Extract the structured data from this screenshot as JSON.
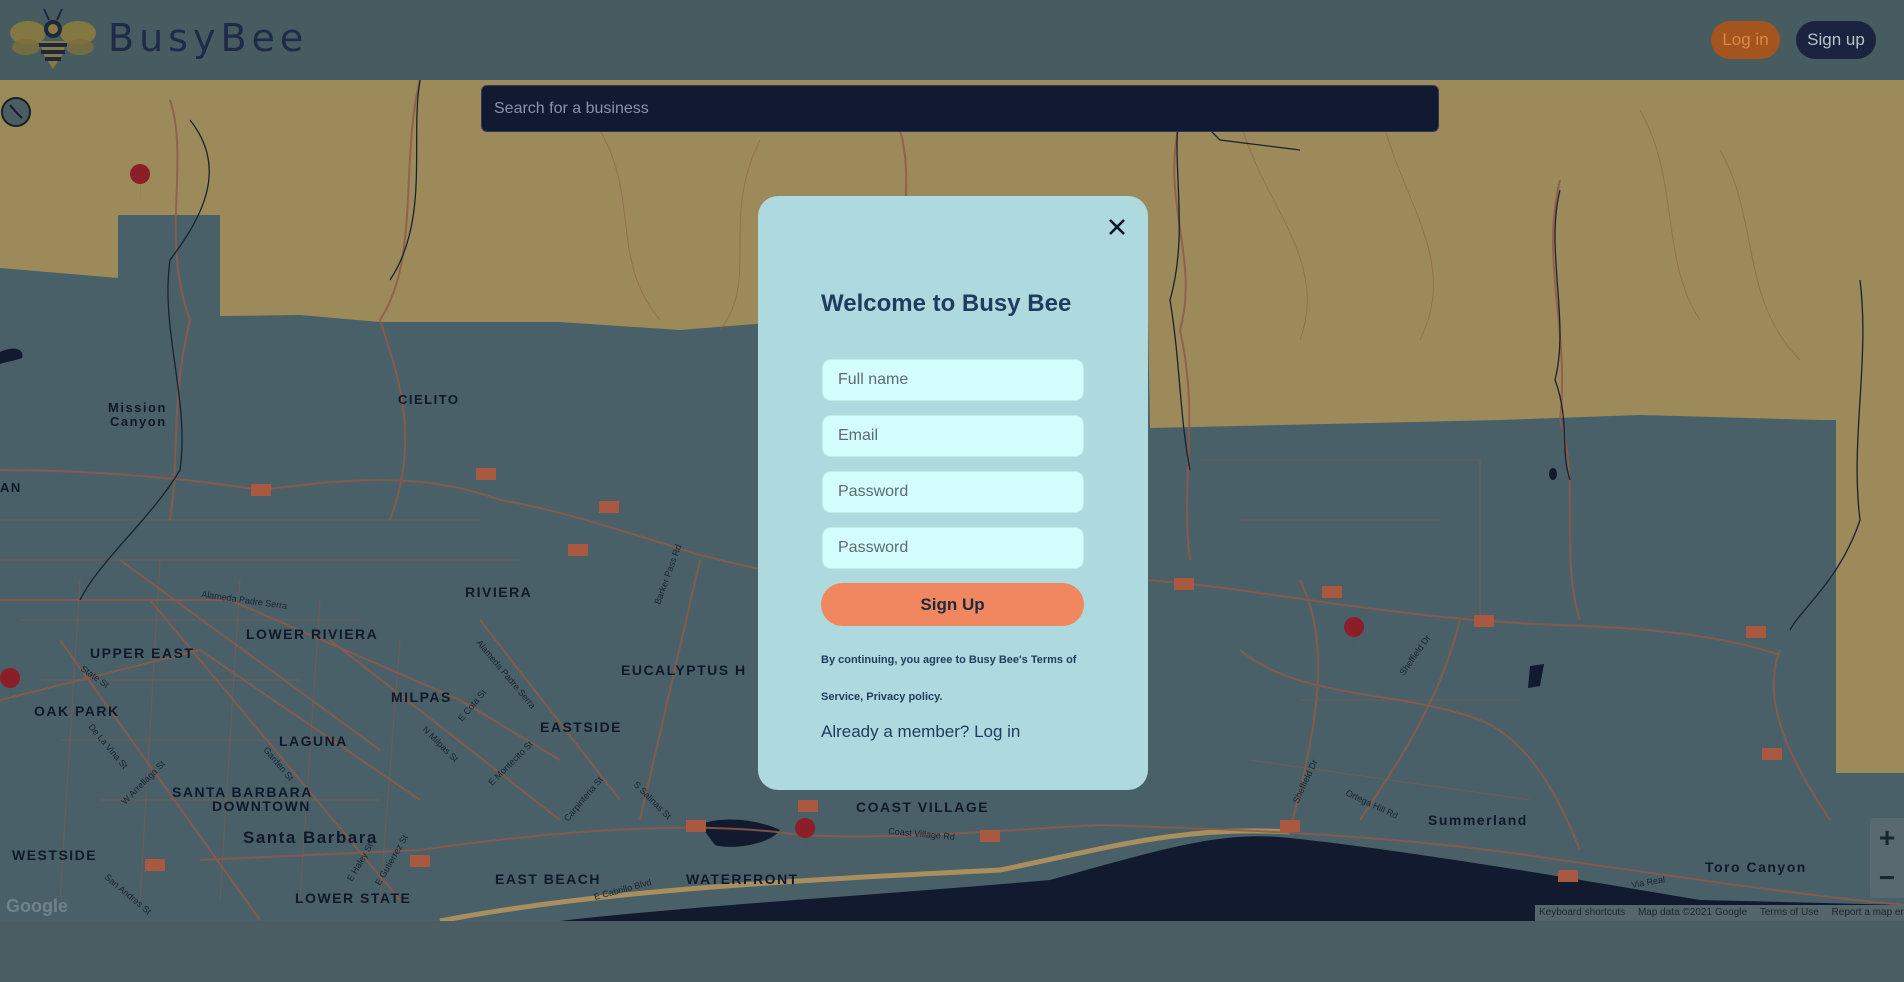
{
  "header": {
    "brand": "BusyBee",
    "login_label": "Log in",
    "signup_label": "Sign up"
  },
  "search": {
    "placeholder": "Search for a business"
  },
  "map": {
    "labels": {
      "cielito": "CIELITO",
      "mission_canyon_1": "Mission",
      "mission_canyon_2": "Canyon",
      "an": "AN",
      "riviera": "RIVIERA",
      "lower_riviera": "LOWER RIVIERA",
      "upper_east": "UPPER EAST",
      "oak_park": "OAK PARK",
      "milpas": "MILPAS",
      "laguna": "LAGUNA",
      "eastside": "EASTSIDE",
      "eucalyptus": "EUCALYPTUS H",
      "sb_downtown_1": "SANTA BARBARA",
      "sb_downtown_2": "DOWNTOWN",
      "santa_barbara": "Santa Barbara",
      "westside": "WESTSIDE",
      "lower_state": "LOWER STATE",
      "east_beach": "EAST BEACH",
      "waterfront": "WATERFRONT",
      "coast_village": "COAST VILLAGE",
      "summerland": "Summerland",
      "toro_canyon": "Toro Canyon"
    },
    "streets": {
      "alameda_padre_serra": "Alameda Padre Serra",
      "barker_pass": "Barker Pass Rd",
      "state_st": "State St",
      "de_la_vina": "De La Vina St",
      "w_arrellaga": "W Arrellaga St",
      "garden_st": "Garden St",
      "n_milpas": "N Milpas St",
      "e_cota": "E Cota St",
      "e_montecito": "E Montecito St",
      "alameda_padre_serra_2": "Alameda Padre Serra",
      "carpinteria_st": "Carpinteria St",
      "s_salinas": "S Salinas St",
      "e_cabrillo": "E Cabrillo Blvd",
      "coast_village_rd": "Coast Village Rd",
      "e_haley": "E Haley St",
      "e_gutierrez": "E Gutierrez St",
      "san_andres": "San Andres St",
      "sheffield_dr": "Sheffield Dr",
      "sheffield_dr_2": "Sheffield Dr",
      "ortega_hill": "Ortega Hill Rd",
      "via_real": "Via Real"
    },
    "google": "Google",
    "attribution": {
      "shortcuts": "Keyboard shortcuts",
      "map_data": "Map data ©2021 Google",
      "terms": "Terms of Use",
      "report": "Report a map error"
    },
    "zoom_in": "+",
    "zoom_out": "−"
  },
  "modal": {
    "title": "Welcome to Busy Bee",
    "fields": {
      "full_name": "Full name",
      "email": "Email",
      "password": "Password",
      "password_confirm": "Password"
    },
    "submit_label": "Sign Up",
    "terms_line1": "By continuing, you agree to Busy Bee's Terms of",
    "terms_line2": "Service, Privacy policy.",
    "member_text": "Already a member? Log in",
    "close_icon": "close-icon"
  },
  "colors": {
    "header_bg": "#475c61",
    "accent_orange": "#f0875f",
    "modal_bg": "#aed9de",
    "field_bg": "#d4fefe",
    "title_navy": "#1f3b5f",
    "search_bg": "#111a31"
  }
}
